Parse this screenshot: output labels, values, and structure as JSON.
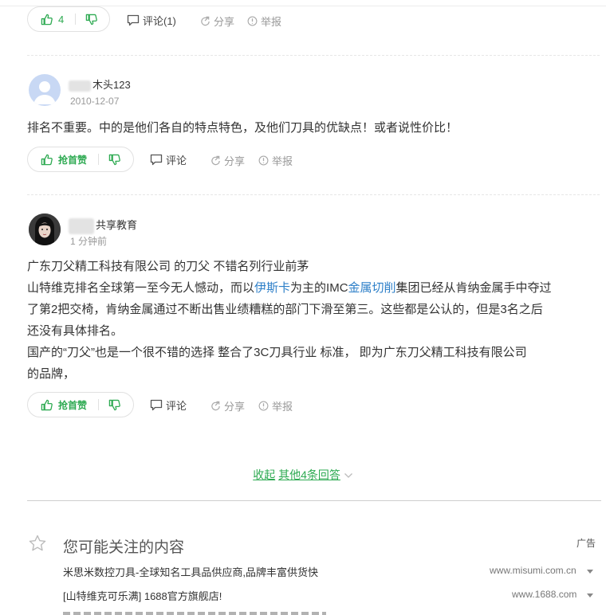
{
  "answers": [
    {
      "vote_up_label": "4",
      "comment_label": "评论(1)",
      "share_label": "分享",
      "report_label": "举报"
    },
    {
      "username": "木头123",
      "date": "2010-12-07",
      "text": "排名不重要。中的是他们各自的特点特色，及他们刀具的优缺点！或者说性价比！",
      "vote_up_label": "抢首赞",
      "comment_label": "评论",
      "share_label": "分享",
      "report_label": "举报"
    },
    {
      "username": "共享教育",
      "date": "1 分钟前",
      "line1": "广东刀父精工科技有限公司 的刀父 不错名列行业前茅",
      "line2_a": "山特维克排名全球第一至今无人憾动，而以",
      "link1": "伊斯卡",
      "line2_b": "为主的IMC",
      "link2": "金属切削",
      "line2_c": "集团已经从肯纳金属手中夺过",
      "line3": "了第2把交椅，肯纳金属通过不断出售业绩糟糕的部门下滑至第三。这些都是公认的，但是3名之后",
      "line4": "还没有具体排名。",
      "line5": "国产的“刀父”也是一个很不错的选择 整合了3C刀具行业 标准， 即为广东刀父精工科技有限公司",
      "line6": "的品牌，",
      "vote_up_label": "抢首赞",
      "comment_label": "评论",
      "share_label": "分享",
      "report_label": "举报"
    }
  ],
  "collapse": {
    "label_a": "收起",
    "label_b": "其他4条回答"
  },
  "recommend": {
    "title": "您可能关注的内容",
    "ad_label": "广告",
    "items": [
      {
        "title": "米思米数控刀具-全球知名工具品供应商,品牌丰富供货快",
        "domain": "www.misumi.com.cn"
      },
      {
        "title": "[山特维克可乐满] 1688官方旗舰店!",
        "domain": "www.1688.com"
      }
    ]
  },
  "colors": {
    "accent_green": "#2eaa52",
    "link_blue": "#2d7fc8"
  }
}
